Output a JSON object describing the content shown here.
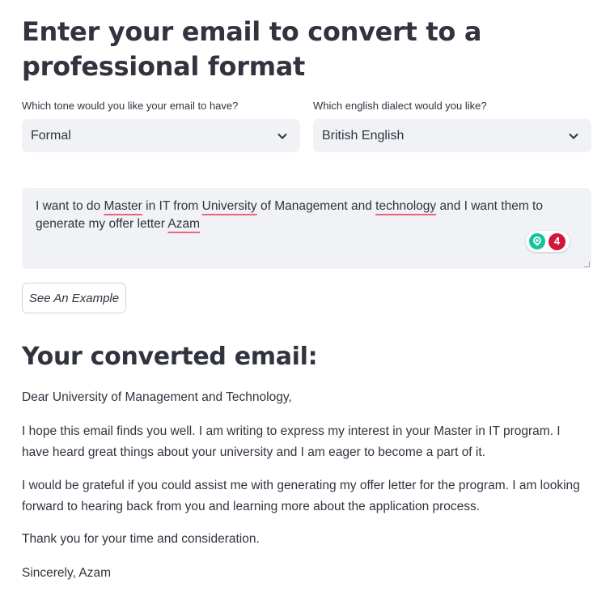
{
  "page": {
    "title": "Enter your email to convert to a professional format"
  },
  "tone": {
    "label": "Which tone would you like your email to have?",
    "value": "Formal"
  },
  "dialect": {
    "label": "Which english dialect would you like?",
    "value": "British English"
  },
  "input": {
    "text_segments": [
      "I want to do ",
      "Master",
      " in IT from ",
      "University",
      " of Management and ",
      "technology",
      " and I want them to generate my offer letter ",
      "Azam"
    ],
    "grammarly_count": "4"
  },
  "example_button": {
    "label": "See An Example"
  },
  "output": {
    "heading": "Your converted email:",
    "paragraphs": [
      "Dear University of Management and Technology,",
      "I hope this email finds you well. I am writing to express my interest in your Master in IT program. I have heard great things about your university and I am eager to become a part of it.",
      "I would be grateful if you could assist me with generating my offer letter for the program. I am looking forward to hearing back from you and learning more about the application process.",
      "Thank you for your time and consideration.",
      "Sincerely, Azam"
    ]
  },
  "icons": {
    "chevron": "chevron-down-icon",
    "grammarly": "grammarly-icon"
  },
  "colors": {
    "field_bg": "#f0f2f6",
    "text": "#31333f",
    "spell_underline": "#e8647f",
    "grammarly_green": "#15c39a",
    "grammarly_badge": "#d3173c"
  }
}
